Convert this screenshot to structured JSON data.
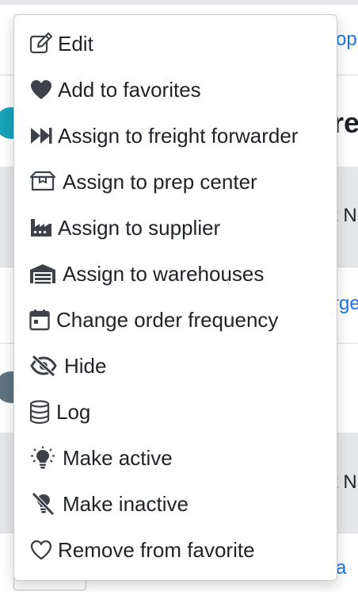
{
  "background": {
    "top_link_fragment": "op",
    "heading_fragment": "re",
    "column_fragment_1": "t N",
    "link_fragment_2": "rge",
    "column_fragment_2": "t N",
    "bottom_link_fragment": "a"
  },
  "menu": {
    "items": [
      {
        "label": "Edit",
        "icon": "edit-icon"
      },
      {
        "label": "Add to favorites",
        "icon": "heart-icon"
      },
      {
        "label": "Assign to freight forwarder",
        "icon": "fast-forward-icon"
      },
      {
        "label": "Assign to prep center",
        "icon": "box-icon"
      },
      {
        "label": "Assign to supplier",
        "icon": "industry-icon"
      },
      {
        "label": "Assign to warehouses",
        "icon": "warehouse-icon"
      },
      {
        "label": "Change order frequency",
        "icon": "calendar-icon"
      },
      {
        "label": "Hide",
        "icon": "eye-slash-icon"
      },
      {
        "label": "Log",
        "icon": "database-icon"
      },
      {
        "label": "Make active",
        "icon": "lightbulb-on-icon"
      },
      {
        "label": "Make inactive",
        "icon": "lightbulb-slash-icon"
      },
      {
        "label": "Remove from favorite",
        "icon": "heart-outline-icon"
      }
    ]
  },
  "colors": {
    "text": "#1f2328",
    "link": "#1a73e8",
    "teal_avatar": "#17a2b8",
    "slate_avatar": "#5f7481"
  }
}
